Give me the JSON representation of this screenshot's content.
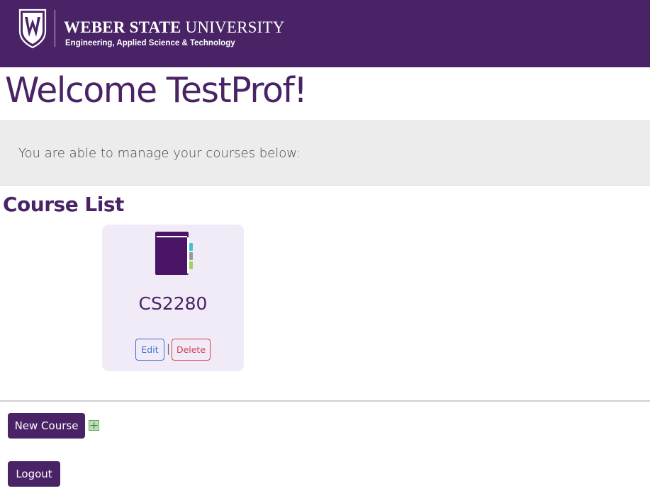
{
  "header": {
    "university_bold": "WEBER STATE",
    "university_rest": "UNIVERSITY",
    "college": "Engineering, Applied Science & Technology",
    "logo_icon": "wsu-shield-logo-icon",
    "background_color": "#4a2366"
  },
  "welcome": {
    "title": "Welcome TestProf!"
  },
  "jumbotron": {
    "text": "You are able to manage your courses below:"
  },
  "course_list": {
    "title": "Course List",
    "courses": [
      {
        "name": "CS2280",
        "icon": "book-icon",
        "edit_label": "Edit",
        "separator": "|",
        "delete_label": "Delete"
      }
    ]
  },
  "actions": {
    "new_course_label": "New Course",
    "new_course_icon": "plus-square-icon",
    "logout_label": "Logout"
  },
  "colors": {
    "brand_purple": "#4a2366",
    "card_background": "#f1ebf8",
    "edit_blue": "#3a6fd8",
    "delete_red": "#d04050"
  }
}
